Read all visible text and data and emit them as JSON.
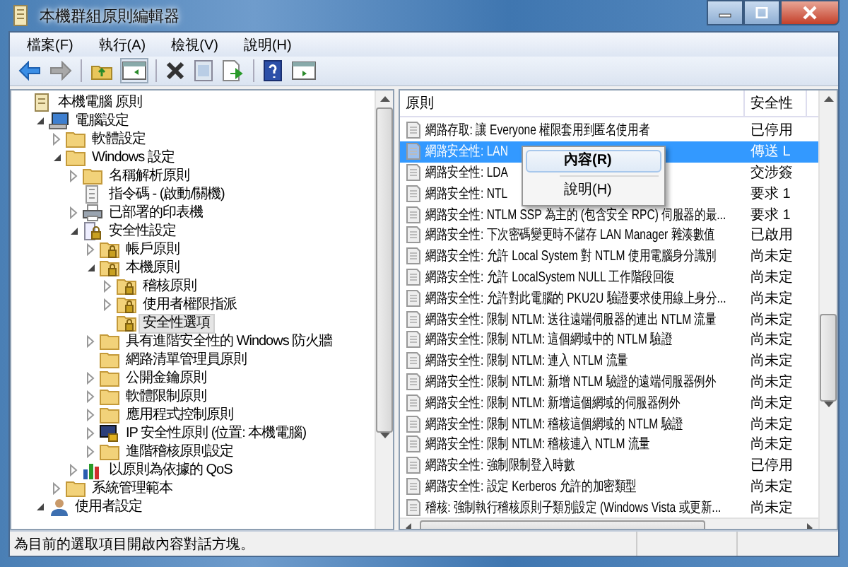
{
  "window": {
    "title": "本機群組原則編輯器"
  },
  "menu": [
    "檔案(F)",
    "執行(A)",
    "檢視(V)",
    "說明(H)"
  ],
  "tree": [
    {
      "label": "本機電腦 原則",
      "kind": "policy",
      "selected": false,
      "children": [
        {
          "label": "電腦設定",
          "kind": "computer",
          "expanded": true,
          "selected": false,
          "children": [
            {
              "label": "軟體設定",
              "kind": "folder",
              "expanded": false,
              "selected": false
            },
            {
              "label": "Windows 設定",
              "kind": "folder",
              "expanded": true,
              "selected": false,
              "children": [
                {
                  "label": "名稱解析原則",
                  "kind": "folder",
                  "expanded": false,
                  "selected": false
                },
                {
                  "label": "指令碼 - (啟動/關機)",
                  "kind": "script",
                  "selected": false
                },
                {
                  "label": "已部署的印表機",
                  "kind": "printer",
                  "expanded": false,
                  "selected": false
                },
                {
                  "label": "安全性設定",
                  "kind": "security",
                  "expanded": true,
                  "selected": false,
                  "children": [
                    {
                      "label": "帳戶原則",
                      "kind": "lock-folder",
                      "expanded": false,
                      "selected": false
                    },
                    {
                      "label": "本機原則",
                      "kind": "lock-folder",
                      "expanded": true,
                      "selected": false,
                      "children": [
                        {
                          "label": "稽核原則",
                          "kind": "lock-folder",
                          "expanded": false,
                          "selected": false
                        },
                        {
                          "label": "使用者權限指派",
                          "kind": "lock-folder",
                          "expanded": false,
                          "selected": false
                        },
                        {
                          "label": "安全性選項",
                          "kind": "lock-folder",
                          "selected": true
                        }
                      ]
                    },
                    {
                      "label": "具有進階安全性的 Windows 防火牆",
                      "kind": "folder",
                      "expanded": false,
                      "selected": false
                    },
                    {
                      "label": "網路清單管理員原則",
                      "kind": "folder",
                      "selected": false
                    },
                    {
                      "label": "公開金鑰原則",
                      "kind": "folder",
                      "expanded": false,
                      "selected": false
                    },
                    {
                      "label": "軟體限制原則",
                      "kind": "folder",
                      "expanded": false,
                      "selected": false
                    },
                    {
                      "label": "應用程式控制原則",
                      "kind": "folder",
                      "expanded": false,
                      "selected": false
                    },
                    {
                      "label": "IP 安全性原則 (位置: 本機電腦)",
                      "kind": "ip",
                      "expanded": false,
                      "selected": false
                    },
                    {
                      "label": "進階稽核原則設定",
                      "kind": "folder",
                      "expanded": false,
                      "selected": false
                    }
                  ]
                },
                {
                  "label": "以原則為依據的 QoS",
                  "kind": "chart",
                  "expanded": false,
                  "selected": false
                }
              ]
            },
            {
              "label": "系統管理範本",
              "kind": "folder",
              "expanded": false,
              "selected": false
            }
          ]
        },
        {
          "label": "使用者設定",
          "kind": "user",
          "expanded": true,
          "selected": false
        }
      ]
    }
  ],
  "list": {
    "columns": [
      "原則",
      "安全性"
    ],
    "rows": [
      {
        "policy": "網路存取: 讓 Everyone 權限套用到匿名使用者",
        "setting": "已停用",
        "selected": false
      },
      {
        "policy": "網路安全性: LAN",
        "setting": "傳送 L",
        "selected": true
      },
      {
        "policy": "網路安全性: LDA",
        "setting": "交涉簽",
        "selected": false
      },
      {
        "policy": "網路安全性: NTL",
        "setting": "要求 1",
        "selected": false
      },
      {
        "policy": "網路安全性: NTLM SSP 為主的 (包含安全 RPC) 伺服器的最...",
        "setting": "要求 1",
        "selected": false
      },
      {
        "policy": "網路安全性: 下次密碼變更時不儲存 LAN Manager 雜湊數值",
        "setting": "已啟用",
        "selected": false
      },
      {
        "policy": "網路安全性: 允許 Local System 對 NTLM 使用電腦身分識別",
        "setting": "尚未定",
        "selected": false
      },
      {
        "policy": "網路安全性: 允許 LocalSystem NULL 工作階段回復",
        "setting": "尚未定",
        "selected": false
      },
      {
        "policy": "網路安全性: 允許對此電腦的 PKU2U 驗證要求使用線上身分...",
        "setting": "尚未定",
        "selected": false
      },
      {
        "policy": "網路安全性: 限制 NTLM: 送往遠端伺服器的連出 NTLM 流量",
        "setting": "尚未定",
        "selected": false
      },
      {
        "policy": "網路安全性: 限制 NTLM: 這個網域中的 NTLM 驗證",
        "setting": "尚未定",
        "selected": false
      },
      {
        "policy": "網路安全性: 限制 NTLM: 連入 NTLM 流量",
        "setting": "尚未定",
        "selected": false
      },
      {
        "policy": "網路安全性: 限制 NTLM: 新增 NTLM 驗證的遠端伺服器例外",
        "setting": "尚未定",
        "selected": false
      },
      {
        "policy": "網路安全性: 限制 NTLM: 新增這個網域的伺服器例外",
        "setting": "尚未定",
        "selected": false
      },
      {
        "policy": "網路安全性: 限制 NTLM: 稽核這個網域的 NTLM 驗證",
        "setting": "尚未定",
        "selected": false
      },
      {
        "policy": "網路安全性: 限制 NTLM: 稽核連入 NTLM 流量",
        "setting": "尚未定",
        "selected": false
      },
      {
        "policy": "網路安全性: 強制限制登入時數",
        "setting": "已停用",
        "selected": false
      },
      {
        "policy": "網路安全性: 設定 Kerberos 允許的加密類型",
        "setting": "尚未定",
        "selected": false
      },
      {
        "policy": "稽核: 強制執行稽核原則子類別設定 (Windows Vista 或更新...",
        "setting": "尚未定",
        "selected": false
      }
    ]
  },
  "context_menu": [
    {
      "label": "內容(R)",
      "selected": true
    },
    {
      "label": "說明(H)",
      "selected": false
    }
  ],
  "status_bar": "為目前的選取項目開啟內容對話方塊。"
}
